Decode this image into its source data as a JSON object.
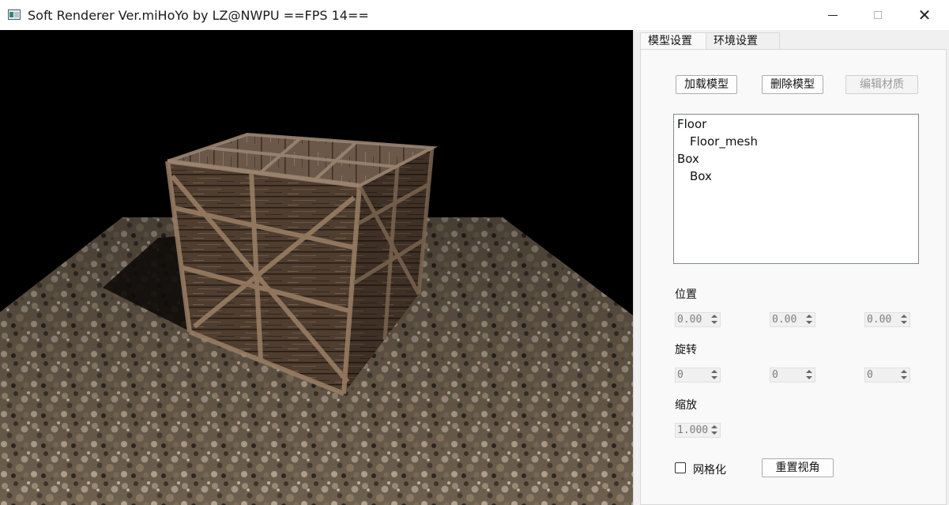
{
  "window": {
    "title": "Soft Renderer Ver.miHoYo by LZ@NWPU ==FPS 14==",
    "icons": {
      "app": "app-icon",
      "minimize": "minimize-icon",
      "maximize": "maximize-icon",
      "close": "close-icon"
    },
    "close_glyph": "✕"
  },
  "tabs": [
    {
      "label": "模型设置",
      "active": true
    },
    {
      "label": "环境设置",
      "active": false
    }
  ],
  "toolbar": {
    "load_label": "加载模型",
    "delete_label": "删除模型",
    "edit_material_label": "编辑材质"
  },
  "tree": [
    {
      "label": "Floor",
      "level": 0
    },
    {
      "label": "Floor_mesh",
      "level": 1
    },
    {
      "label": "Box",
      "level": 0
    },
    {
      "label": "Box",
      "level": 1
    }
  ],
  "transform": {
    "position_label": "位置",
    "position": [
      "0.00",
      "0.00",
      "0.00"
    ],
    "rotation_label": "旋转",
    "rotation": [
      "0",
      "0",
      "0"
    ],
    "scale_label": "缩放",
    "scale": "1.000"
  },
  "options": {
    "wireframe_label": "网格化",
    "wireframe_checked": false,
    "reset_view_label": "重置视角"
  },
  "colors": {
    "viewport_bg": "#000000",
    "panel_bg": "#f0f0f0",
    "crate_wood": "#5a4535",
    "floor_gravel": "#6b5d4c"
  }
}
